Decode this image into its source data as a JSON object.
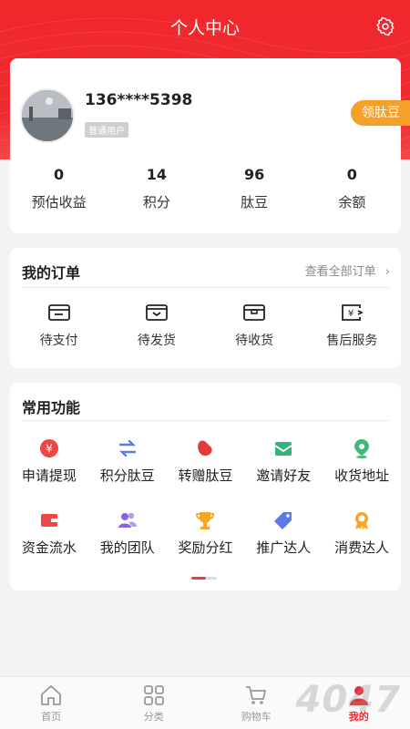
{
  "header": {
    "title": "个人中心",
    "settings_icon": "gear-icon"
  },
  "profile": {
    "phone": "136****5398",
    "level": "普通用户",
    "beans_button": "领肽豆",
    "stats": [
      {
        "value": "0",
        "label": "预估收益"
      },
      {
        "value": "14",
        "label": "积分"
      },
      {
        "value": "96",
        "label": "肽豆"
      },
      {
        "value": "0",
        "label": "余额"
      }
    ]
  },
  "orders": {
    "title": "我的订单",
    "view_all": "查看全部订单",
    "items": [
      {
        "label": "待支付",
        "icon": "wallet-icon"
      },
      {
        "label": "待发货",
        "icon": "box-check-icon"
      },
      {
        "label": "待收货",
        "icon": "package-icon"
      },
      {
        "label": "售后服务",
        "icon": "refund-icon"
      }
    ]
  },
  "functions": {
    "title": "常用功能",
    "items": [
      {
        "label": "申请提现",
        "icon": "yen-coin-icon",
        "color": "#f04646"
      },
      {
        "label": "积分肽豆",
        "icon": "exchange-arrows-icon",
        "color": "#5b7be6"
      },
      {
        "label": "转赠肽豆",
        "icon": "bean-icon",
        "color": "#e53a3a"
      },
      {
        "label": "邀请好友",
        "icon": "envelope-icon",
        "color": "#34b37e"
      },
      {
        "label": "收货地址",
        "icon": "location-pin-icon",
        "color": "#3fb87a"
      },
      {
        "label": "资金流水",
        "icon": "wallet-flow-icon",
        "color": "#f04646"
      },
      {
        "label": "我的团队",
        "icon": "team-icon",
        "color": "#8a63e0"
      },
      {
        "label": "奖励分红",
        "icon": "trophy-icon",
        "color": "#f5a623"
      },
      {
        "label": "推广达人",
        "icon": "tag-icon",
        "color": "#5b7be6"
      },
      {
        "label": "消费达人",
        "icon": "medal-icon",
        "color": "#f5a623"
      }
    ]
  },
  "tabbar": {
    "items": [
      {
        "label": "首页",
        "icon": "home-icon"
      },
      {
        "label": "分类",
        "icon": "grid-icon"
      },
      {
        "label": "购物车",
        "icon": "cart-icon"
      },
      {
        "label": "我的",
        "icon": "user-icon",
        "active": true
      }
    ]
  },
  "colors": {
    "brand": "#ee2a30",
    "accent": "#f5a02a"
  }
}
